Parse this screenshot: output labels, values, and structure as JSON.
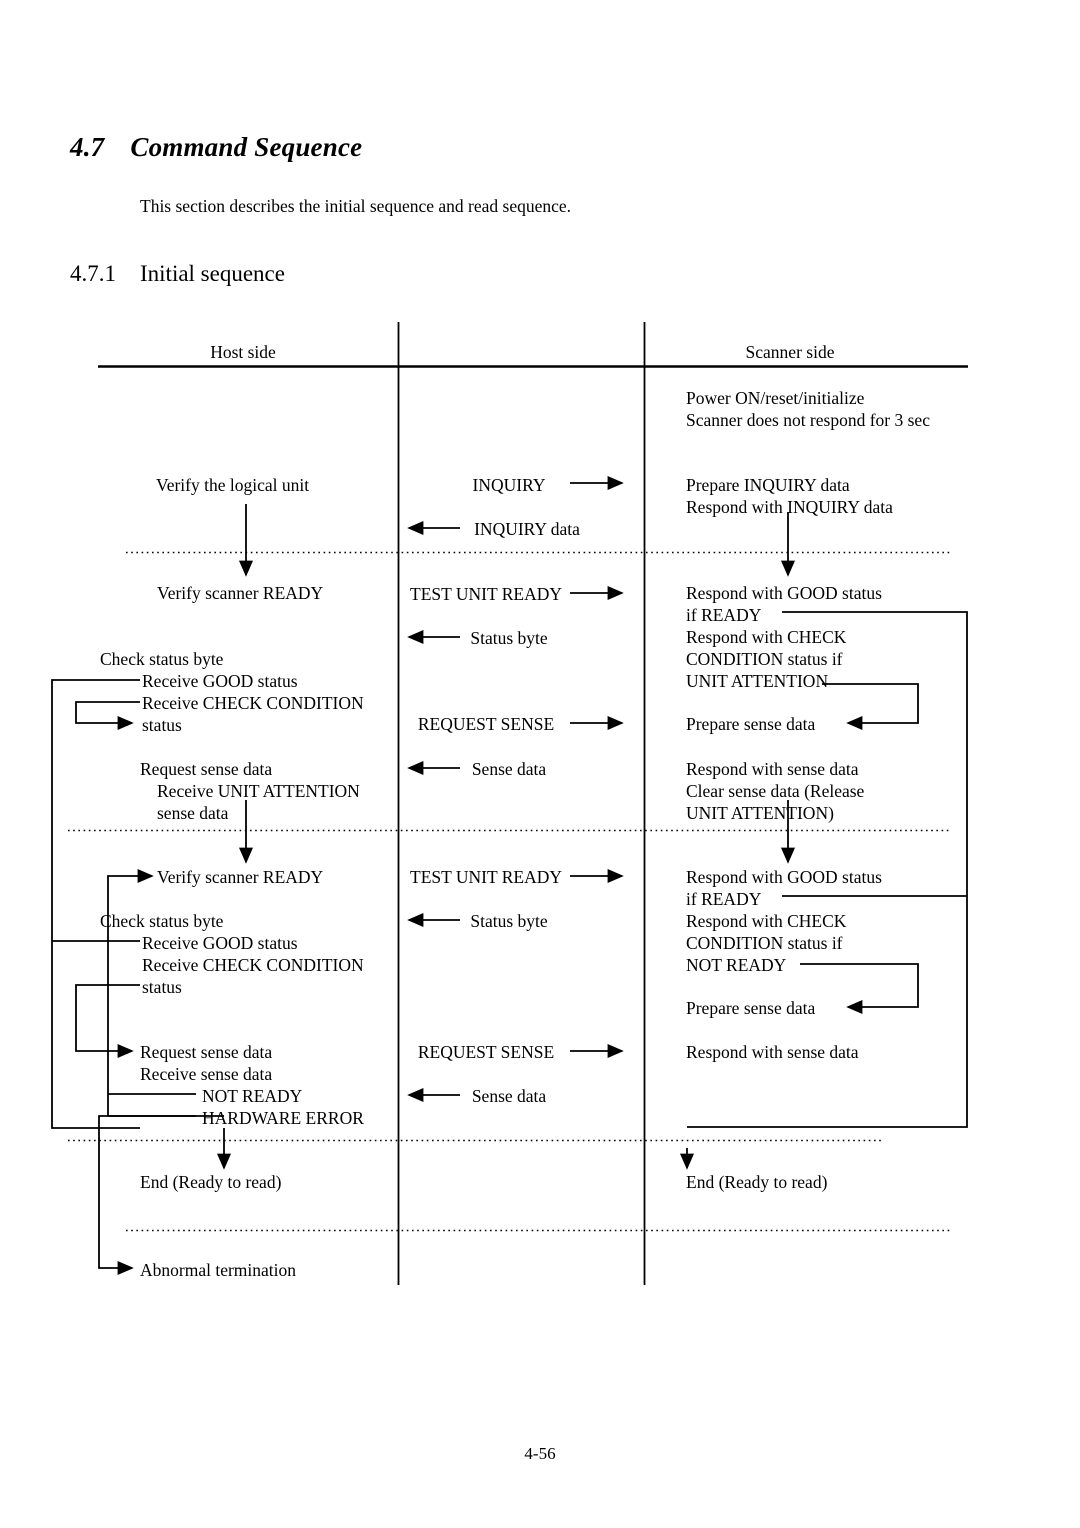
{
  "section": {
    "number": "4.7",
    "title": "Command Sequence",
    "intro": "This section describes the initial sequence and read sequence.",
    "sub_number": "4.7.1",
    "sub_title": "Initial sequence"
  },
  "page_number": "4-56",
  "diagram": {
    "columns": {
      "host": "Host side",
      "scanner": "Scanner side"
    },
    "host_steps": [
      "Verify the logical unit",
      "Verify scanner READY",
      "Check status byte",
      "Receive GOOD status",
      "Receive CHECK CONDITION",
      "status",
      "Request sense data",
      "Receive UNIT ATTENTION",
      "sense data",
      "Verify scanner READY",
      "Check status byte",
      "Receive GOOD status",
      "Receive CHECK CONDITION",
      "status",
      "Request sense data",
      "Receive sense data",
      "NOT READY",
      "HARDWARE ERROR",
      "End (Ready to read)",
      "Abnormal termination"
    ],
    "bus_messages": [
      "INQUIRY",
      "INQUIRY data",
      "TEST UNIT READY",
      "Status byte",
      "REQUEST SENSE",
      "Sense data",
      "TEST UNIT READY",
      "Status byte",
      "REQUEST SENSE",
      "Sense data"
    ],
    "scanner_steps": [
      "Power ON/reset/initialize",
      "Scanner does not respond for 3 sec",
      "Prepare INQUIRY data",
      "Respond with INQUIRY data",
      "Respond with GOOD status",
      "if READY",
      "Respond with CHECK",
      "CONDITION status if",
      "UNIT ATTENTION",
      "Prepare sense data",
      "Respond with sense data",
      "Clear sense data (Release",
      "UNIT ATTENTION)",
      "Respond with GOOD status",
      "if READY",
      "Respond with CHECK",
      "CONDITION status if",
      "NOT READY",
      "Prepare sense data",
      "Respond with sense data",
      "End (Ready to read)"
    ]
  }
}
